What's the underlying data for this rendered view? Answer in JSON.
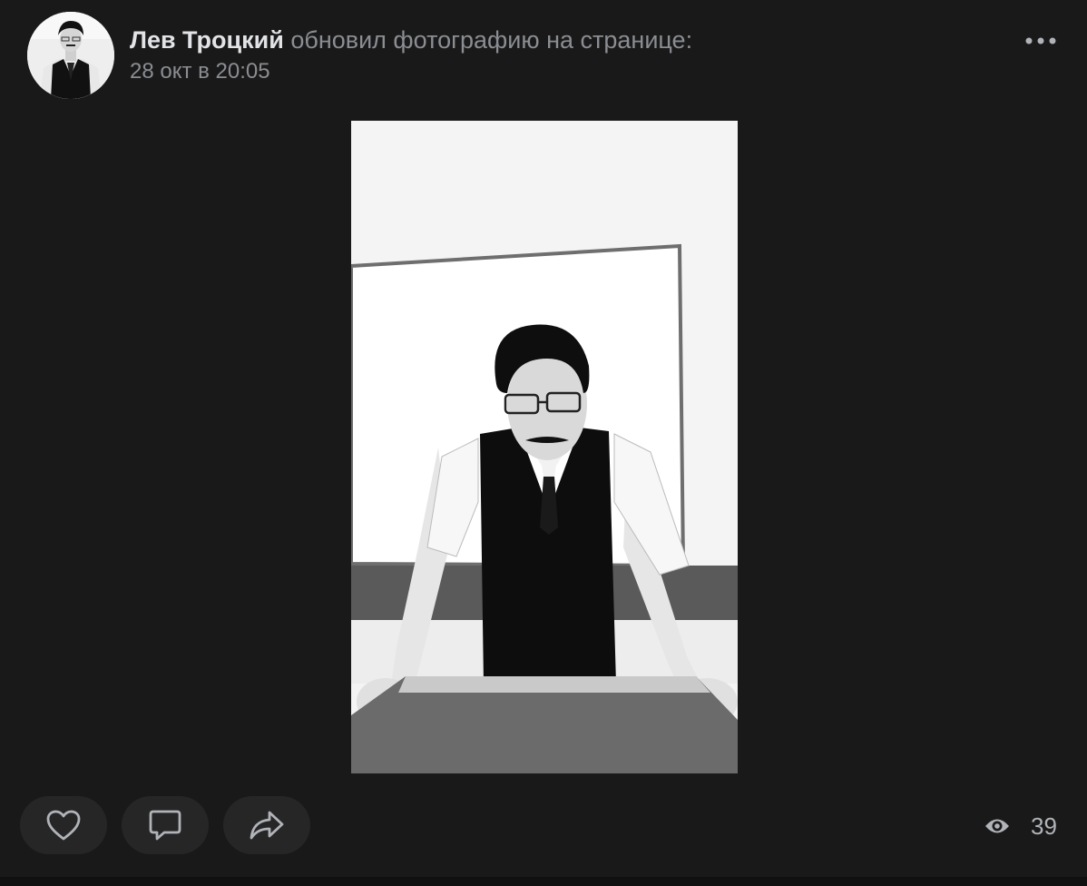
{
  "post": {
    "author": "Лев Троцкий",
    "action": "обновил фотографию на странице:",
    "date": "28 окт в 20:05"
  },
  "icons": {
    "more": "more-horizontal-icon",
    "like": "heart-icon",
    "comment": "comment-bubble-icon",
    "share": "share-arrow-icon",
    "views": "eye-icon"
  },
  "footer": {
    "views_count": "39"
  },
  "colors": {
    "background": "#191919",
    "button_bg": "#262626",
    "author_text": "#e1e3e6",
    "secondary_text": "#8a8d92"
  }
}
